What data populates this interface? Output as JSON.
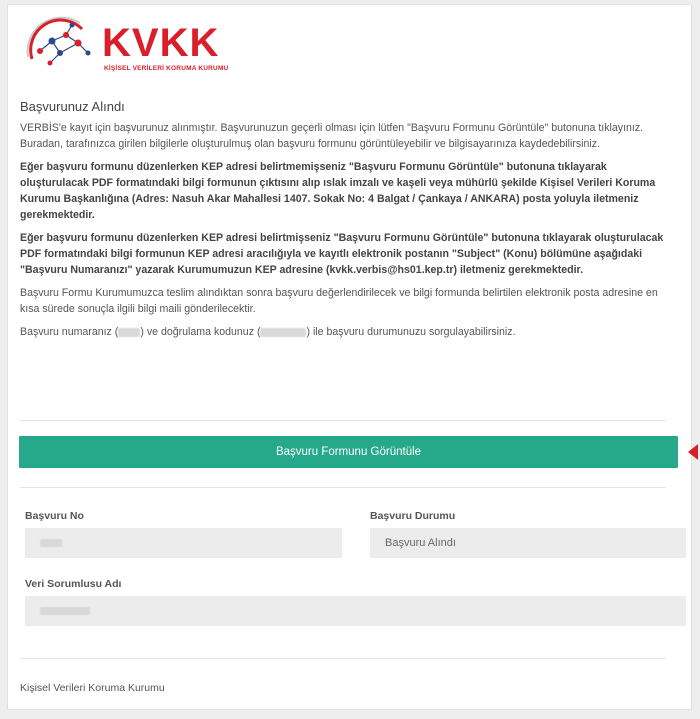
{
  "logo": {
    "brand": "KVKK",
    "subtitle": "KİŞİSEL VERİLERİ KORUMA KURUMU"
  },
  "heading": "Başvurunuz Alındı",
  "paragraphs": {
    "p1": "VERBİS'e kayıt için başvurunuz alınmıştır. Başvurunuzun geçerli olması için lütfen \"Başvuru Formunu Görüntüle\" butonuna tıklayınız. Buradan, tarafınızca girilen bilgilerle oluşturulmuş olan başvuru formunu görüntüleyebilir ve bilgisayarınıza kaydedebilirsiniz.",
    "p2": "Eğer başvuru formunu düzenlerken KEP adresi belirtmemişseniz \"Başvuru Formunu Görüntüle\" butonuna tıklayarak oluşturulacak PDF formatındaki bilgi formunun çıktısını alıp ıslak imzalı ve kaşeli veya mühürlü şekilde Kişisel Verileri Koruma Kurumu Başkanlığına (Adres: Nasuh Akar Mahallesi 1407. Sokak No: 4 Balgat / Çankaya / ANKARA) posta yoluyla iletmeniz gerekmektedir.",
    "p3": "Eğer başvuru formunu düzenlerken KEP adresi belirtmişseniz \"Başvuru Formunu Görüntüle\" butonuna tıklayarak oluşturulacak PDF formatındaki bilgi formunun KEP adresi aracılığıyla ve kayıtlı elektronik postanın \"Subject\" (Konu) bölümüne aşağıdaki \"Başvuru Numaranızı\" yazarak Kurumumuzun KEP adresine (kvkk.verbis@hs01.kep.tr) iletmeniz gerekmektedir.",
    "p4": "Başvuru Formu Kurumumuzca teslim alındıktan sonra başvuru değerlendirilecek ve bilgi formunda belirtilen elektronik posta adresine en kısa sürede sonuçla ilgili bilgi maili gönderilecektir.",
    "p5_a": "Başvuru numaranız (",
    "p5_b": ") ve doğrulama kodunuz (",
    "p5_c": ") ile başvuru durumunuzu sorgulayabilirsiniz."
  },
  "button_label": "Başvuru Formunu Görüntüle",
  "form": {
    "app_no_label": "Başvuru No",
    "status_label": "Başvuru Durumu",
    "status_value": "Başvuru Alındı",
    "controller_label": "Veri Sorumlusu Adı"
  },
  "footer": "Kişisel Verileri Koruma Kurumu",
  "colors": {
    "brand_red": "#d81f2a",
    "button_green": "#26a98a"
  }
}
